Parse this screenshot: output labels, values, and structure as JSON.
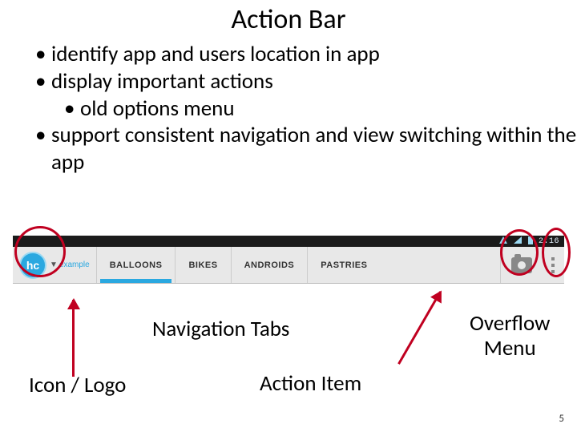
{
  "title": "Action Bar",
  "bullets": {
    "b1": "identify app and users location in app",
    "b2": "display important actions",
    "b2a": "old options menu",
    "b3": "support consistent navigation and view switching within the app"
  },
  "status": {
    "time": "2:16"
  },
  "actionbar": {
    "app_icon_text": "hc",
    "app_title": "example",
    "tabs": [
      "BALLOONS",
      "BIKES",
      "ANDROIDS",
      "PASTRIES"
    ],
    "selected_tab_index": 0
  },
  "annotations": {
    "nav_tabs": "Navigation Tabs",
    "action_item": "Action Item",
    "overflow_menu": "Overflow\nMenu",
    "icon_logo": "Icon / Logo"
  },
  "page_number": "5"
}
